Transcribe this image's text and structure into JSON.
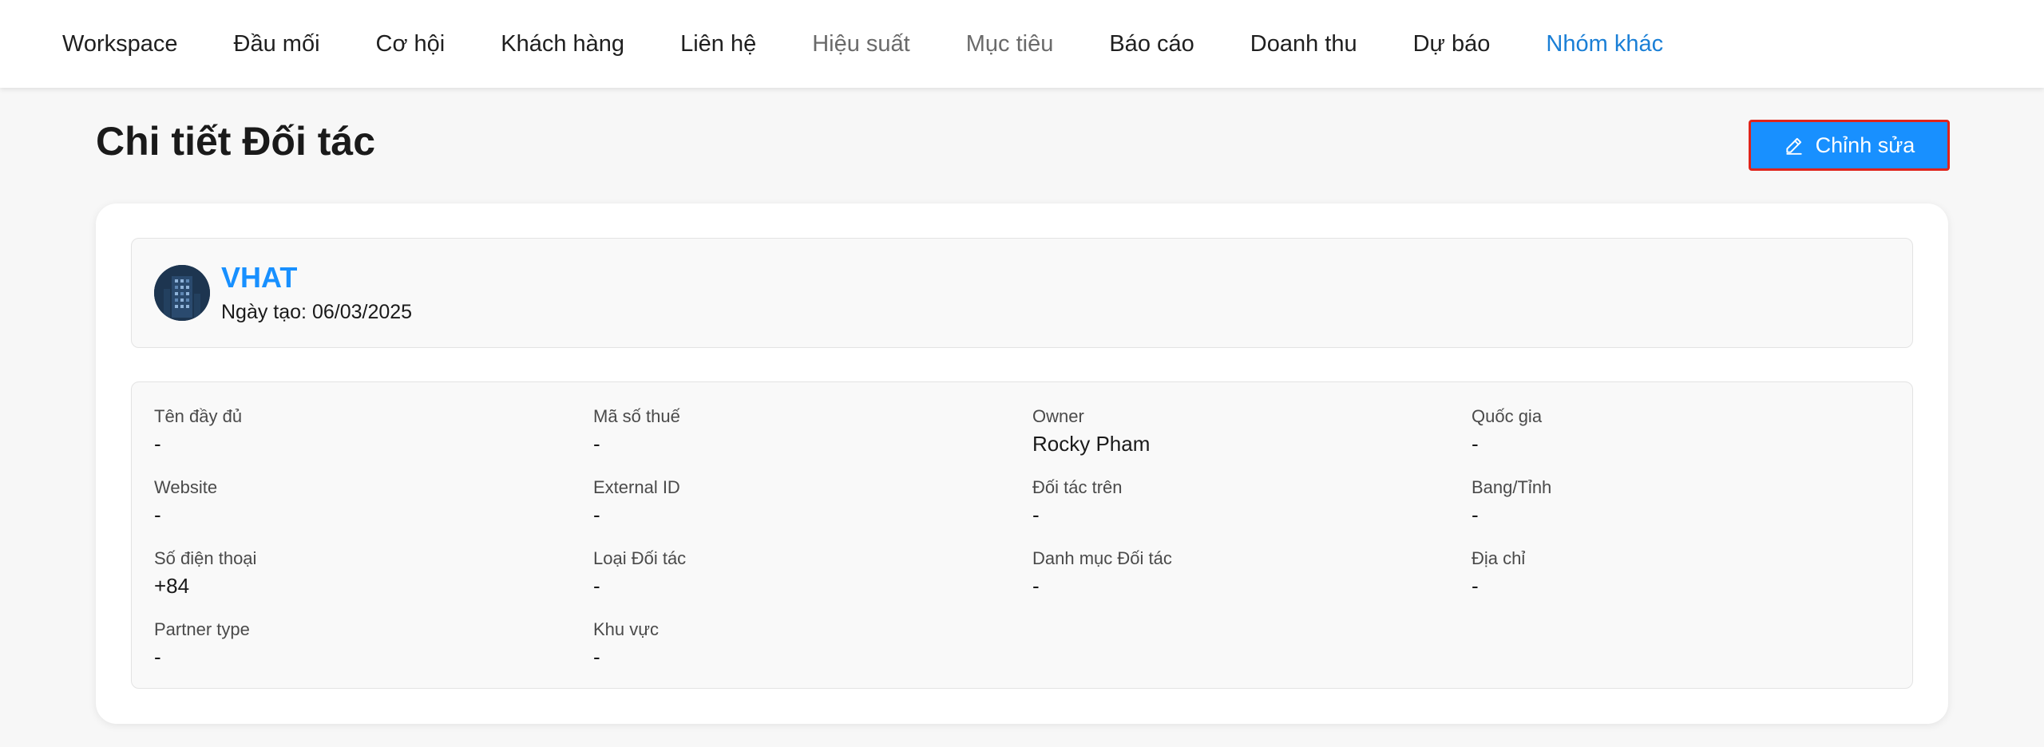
{
  "nav": {
    "items": [
      {
        "label": "Workspace",
        "state": "normal"
      },
      {
        "label": "Đầu mối",
        "state": "normal"
      },
      {
        "label": "Cơ hội",
        "state": "normal"
      },
      {
        "label": "Khách hàng",
        "state": "normal"
      },
      {
        "label": "Liên hệ",
        "state": "normal"
      },
      {
        "label": "Hiệu suất",
        "state": "muted"
      },
      {
        "label": "Mục tiêu",
        "state": "muted"
      },
      {
        "label": "Báo cáo",
        "state": "normal"
      },
      {
        "label": "Doanh thu",
        "state": "normal"
      },
      {
        "label": "Dự báo",
        "state": "normal"
      },
      {
        "label": "Nhóm khác",
        "state": "active"
      }
    ]
  },
  "page": {
    "title": "Chi tiết Đối tác",
    "edit_label": "Chỉnh sửa"
  },
  "profile": {
    "name": "VHAT",
    "created": "Ngày tạo: 06/03/2025"
  },
  "details": {
    "fields": [
      {
        "label": "Tên đầy đủ",
        "value": "-"
      },
      {
        "label": "Mã số thuế",
        "value": "-"
      },
      {
        "label": "Owner",
        "value": "Rocky Pham"
      },
      {
        "label": "Quốc gia",
        "value": "-"
      },
      {
        "label": "Website",
        "value": "-"
      },
      {
        "label": "External ID",
        "value": "-"
      },
      {
        "label": "Đối tác trên",
        "value": "-"
      },
      {
        "label": "Bang/Tỉnh",
        "value": "-"
      },
      {
        "label": "Số điện thoại",
        "value": "+84"
      },
      {
        "label": "Loại Đối tác",
        "value": "-"
      },
      {
        "label": "Danh mục Đối tác",
        "value": "-"
      },
      {
        "label": "Địa chỉ",
        "value": "-"
      },
      {
        "label": "Partner type",
        "value": "-"
      },
      {
        "label": "Khu vực",
        "value": "-"
      }
    ]
  },
  "colors": {
    "accent": "#1890ff",
    "nav_active": "#1a7fd6",
    "highlight_border": "#e0241b",
    "background": "#f7f7f7"
  },
  "icons": {
    "edit": "pencil-icon",
    "avatar": "building-icon"
  }
}
